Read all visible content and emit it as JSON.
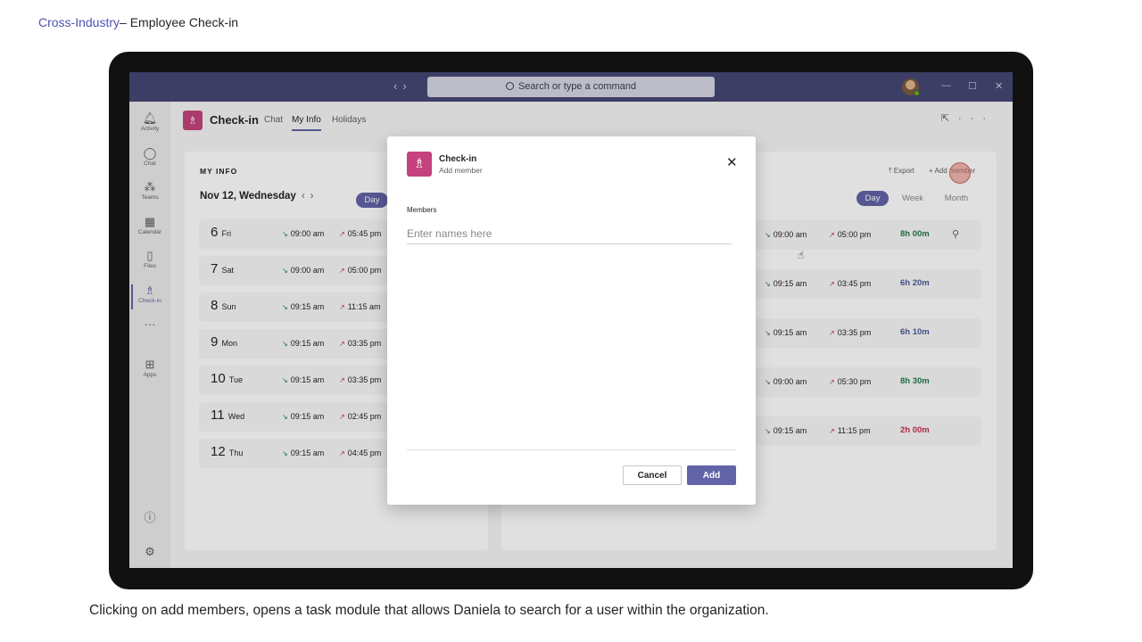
{
  "page": {
    "header_link": "Cross-Industry",
    "header_rest": "– Employee Check-in",
    "caption": "Clicking on add members, opens a task module that allows Daniela to search for a user within the organization."
  },
  "titlebar": {
    "search_placeholder": "Search or type a command",
    "back_icon": "chevron-left-icon",
    "forward_icon": "chevron-right-icon"
  },
  "rail": {
    "items": [
      {
        "label": "Activity",
        "icon": "bell-icon"
      },
      {
        "label": "Chat",
        "icon": "chat-icon"
      },
      {
        "label": "Teams",
        "icon": "teams-icon"
      },
      {
        "label": "Calendar",
        "icon": "calendar-icon"
      },
      {
        "label": "Files",
        "icon": "file-icon"
      },
      {
        "label": "Check-in",
        "icon": "checkin-icon"
      },
      {
        "label": "",
        "icon": "more-icon"
      },
      {
        "label": "Apps",
        "icon": "apps-icon"
      }
    ]
  },
  "app": {
    "title": "Check-in",
    "tabs": [
      "Chat",
      "My Info",
      "Holidays"
    ],
    "active_tab": "My Info"
  },
  "my_info": {
    "heading": "MY INFO",
    "date": "Nov 12, Wednesday",
    "view_day": "Day",
    "rows": [
      {
        "num": "6",
        "day": "Fri",
        "in": "09:00 am",
        "out": "05:45 pm"
      },
      {
        "num": "7",
        "day": "Sat",
        "in": "09:00 am",
        "out": "05:00 pm"
      },
      {
        "num": "8",
        "day": "Sun",
        "in": "09:15 am",
        "out": "11:15 am"
      },
      {
        "num": "9",
        "day": "Mon",
        "in": "09:15 am",
        "out": "03:35 pm"
      },
      {
        "num": "10",
        "day": "Tue",
        "in": "09:15 am",
        "out": "03:35 pm"
      },
      {
        "num": "11",
        "day": "Wed",
        "in": "09:15 am",
        "out": "02:45 pm"
      },
      {
        "num": "12",
        "day": "Thu",
        "in": "09:15 am",
        "out": "04:45 pm"
      }
    ]
  },
  "team_info": {
    "export_label": "Export",
    "add_member_label": "Add member",
    "views": [
      "Day",
      "Week",
      "Month"
    ],
    "active_view": "Day",
    "rows": [
      {
        "in": "09:00 am",
        "out": "05:00 pm",
        "duration": "8h 00m",
        "duration_color": "#237b4b"
      },
      {
        "in": "09:15 am",
        "out": "03:45 pm",
        "duration": "6h 20m",
        "duration_color": "#4a5a9c"
      },
      {
        "in": "09:15 am",
        "out": "03:35 pm",
        "duration": "6h 10m",
        "duration_color": "#4a5a9c"
      },
      {
        "in": "09:00 am",
        "out": "05:30 pm",
        "duration": "8h 30m",
        "duration_color": "#237b4b"
      },
      {
        "in": "09:15 am",
        "out": "11:15 pm",
        "duration": "2h 00m",
        "duration_color": "#c4314b"
      }
    ]
  },
  "dialog": {
    "title": "Check-in",
    "subtitle": "Add member",
    "members_label": "Members",
    "members_placeholder": "Enter names here",
    "members_value": "",
    "cancel_label": "Cancel",
    "add_label": "Add"
  },
  "colors": {
    "accent": "#6264a7",
    "titlebar": "#464775",
    "app_icon": "#c4427d"
  }
}
